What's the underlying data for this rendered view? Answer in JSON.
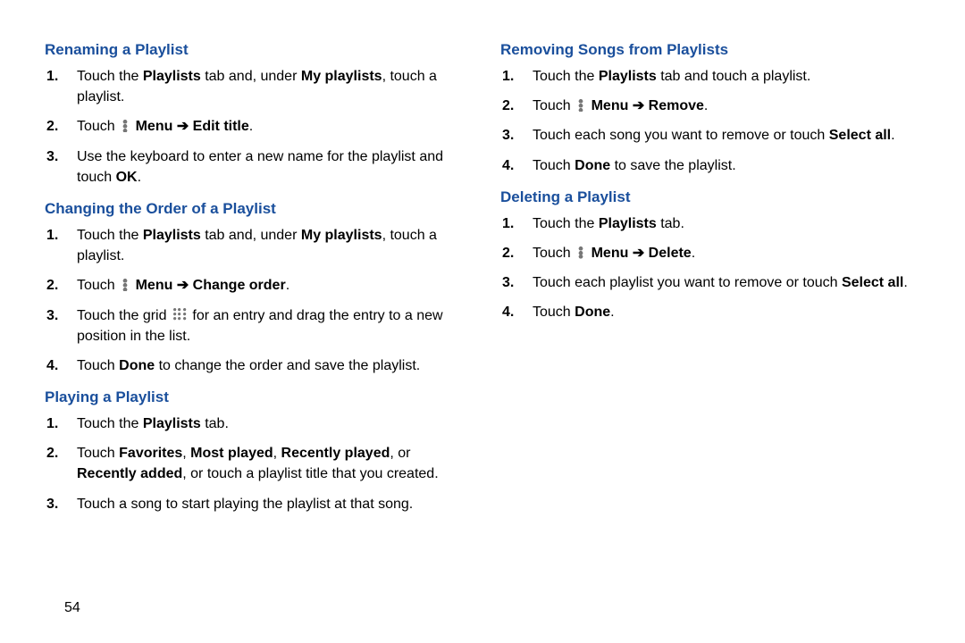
{
  "page_number": "54",
  "arrow": "➔",
  "sections": {
    "rename": {
      "title": "Renaming a Playlist",
      "s1a": "Touch the ",
      "s1b": "Playlists",
      "s1c": " tab and, under ",
      "s1d": "My playlists",
      "s1e": ", touch a playlist.",
      "s2a": "Touch ",
      "s2b": "Menu ",
      "s2c": " Edit title",
      "s2d": ".",
      "s3a": "Use the keyboard to enter a new name for the playlist and touch ",
      "s3b": "OK",
      "s3c": "."
    },
    "order": {
      "title": "Changing the Order of a Playlist",
      "s1a": "Touch the ",
      "s1b": "Playlists",
      "s1c": " tab and, under ",
      "s1d": "My playlists",
      "s1e": ", touch a playlist.",
      "s2a": "Touch ",
      "s2b": "Menu ",
      "s2c": " Change order",
      "s2d": ".",
      "s3a": "Touch the grid ",
      "s3b": " for an entry and drag the entry to a new position in the list.",
      "s4a": "Touch ",
      "s4b": "Done",
      "s4c": " to change the order and save the playlist."
    },
    "play": {
      "title": "Playing a Playlist",
      "s1a": "Touch the ",
      "s1b": "Playlists",
      "s1c": " tab.",
      "s2a": "Touch ",
      "s2b": "Favorites",
      "s2c": ", ",
      "s2d": "Most played",
      "s2e": ", ",
      "s2f": "Recently played",
      "s2g": ", or ",
      "s2h": "Recently added",
      "s2i": ", or touch a playlist title that you created.",
      "s3a": "Touch a song to start playing the playlist at that song."
    },
    "remove": {
      "title": "Removing Songs from Playlists",
      "s1a": "Touch the ",
      "s1b": "Playlists",
      "s1c": " tab and touch a playlist.",
      "s2a": "Touch ",
      "s2b": "Menu ",
      "s2c": " Remove",
      "s2d": ".",
      "s3a": "Touch each song you want to remove or touch ",
      "s3b": "Select all",
      "s3c": ".",
      "s4a": "Touch ",
      "s4b": "Done",
      "s4c": " to save the playlist."
    },
    "delete": {
      "title": "Deleting a Playlist",
      "s1a": "Touch the ",
      "s1b": "Playlists",
      "s1c": " tab.",
      "s2a": "Touch ",
      "s2b": "Menu ",
      "s2c": " Delete",
      "s2d": ".",
      "s3a": "Touch each playlist you want to remove or touch ",
      "s3b": "Select all",
      "s3c": ".",
      "s4a": "Touch ",
      "s4b": "Done",
      "s4c": "."
    }
  }
}
